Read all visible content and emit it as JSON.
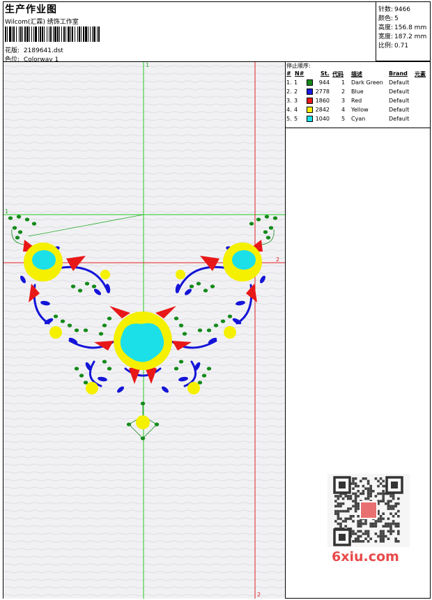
{
  "header": {
    "title": "生产作业图",
    "company": "Wilcom(汇霖) 绣饰工作室",
    "pattern_label": "花版:",
    "pattern_value": "2189641.dst",
    "color_label": "色位:",
    "color_value": "Colorway 1"
  },
  "stats": [
    {
      "label": "针数:",
      "value": "9466"
    },
    {
      "label": "颜色:",
      "value": "5"
    },
    {
      "label": "高度:",
      "value": "156.8 mm"
    },
    {
      "label": "宽度:",
      "value": "187.2 mm"
    },
    {
      "label": "比例:",
      "value": "0.71"
    }
  ],
  "stop_sequence": {
    "title": "停止顺序:",
    "headers": {
      "idx": "#",
      "no": "N#",
      "st": "St.",
      "code": "代码",
      "desc": "描述",
      "brand": "Brand",
      "elem": "元素"
    },
    "rows": [
      {
        "idx": "1.",
        "no": "1",
        "color": "#148a1a",
        "st": "944",
        "code": "1",
        "desc": "Dark Green",
        "brand": "Default"
      },
      {
        "idx": "2.",
        "no": "2",
        "color": "#1a1ae0",
        "st": "2778",
        "code": "2",
        "desc": "Blue",
        "brand": "Default"
      },
      {
        "idx": "3.",
        "no": "3",
        "color": "#e81818",
        "st": "1860",
        "code": "3",
        "desc": "Red",
        "brand": "Default"
      },
      {
        "idx": "4.",
        "no": "4",
        "color": "#f5f000",
        "st": "2842",
        "code": "4",
        "desc": "Yellow",
        "brand": "Default"
      },
      {
        "idx": "5.",
        "no": "5",
        "color": "#1ce0e8",
        "st": "1040",
        "code": "5",
        "desc": "Cyan",
        "brand": "Default"
      }
    ]
  },
  "canvas": {
    "guide_top_label": "1",
    "guide_left_label": "1",
    "guide_right_label": "2",
    "guide_bottom_label": "2"
  },
  "watermark": {
    "text": "6xiu.com"
  }
}
